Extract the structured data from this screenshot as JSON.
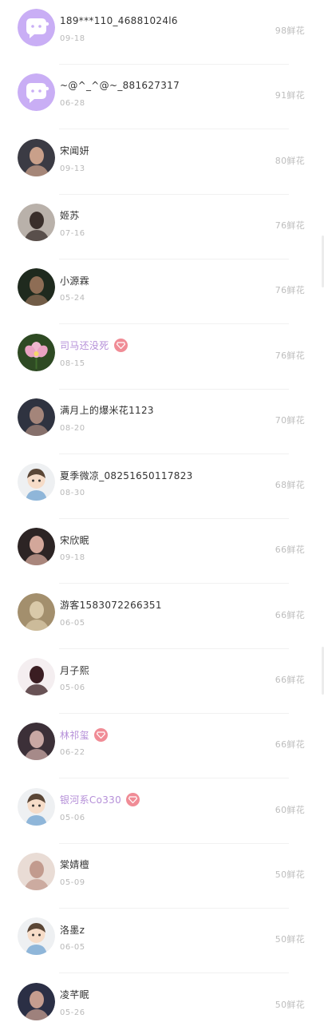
{
  "rows": [
    {
      "name": "189***110_46881024l6",
      "date": "09-18",
      "flowers": "98鲜花",
      "vip": false,
      "avatar": "default"
    },
    {
      "name": "~@^_^@~_881627317",
      "date": "06-28",
      "flowers": "91鲜花",
      "vip": false,
      "avatar": "default"
    },
    {
      "name": "宋闻妍",
      "date": "09-13",
      "flowers": "80鲜花",
      "vip": false,
      "avatar": "photo"
    },
    {
      "name": "姬苏",
      "date": "07-16",
      "flowers": "76鲜花",
      "vip": false,
      "avatar": "photo"
    },
    {
      "name": "小源霖",
      "date": "05-24",
      "flowers": "76鲜花",
      "vip": false,
      "avatar": "photo"
    },
    {
      "name": "司马还没死",
      "date": "08-15",
      "flowers": "76鲜花",
      "vip": true,
      "avatar": "flower"
    },
    {
      "name": "满月上的爆米花1123",
      "date": "08-20",
      "flowers": "70鲜花",
      "vip": false,
      "avatar": "photo"
    },
    {
      "name": "夏季微凉_08251650117823",
      "date": "08-30",
      "flowers": "68鲜花",
      "vip": false,
      "avatar": "cartoon"
    },
    {
      "name": "宋欣眠",
      "date": "09-18",
      "flowers": "66鲜花",
      "vip": false,
      "avatar": "photo"
    },
    {
      "name": "游客1583072266351",
      "date": "06-05",
      "flowers": "66鲜花",
      "vip": false,
      "avatar": "photo"
    },
    {
      "name": "月子熙",
      "date": "05-06",
      "flowers": "66鲜花",
      "vip": false,
      "avatar": "photo"
    },
    {
      "name": "林祁玺",
      "date": "06-22",
      "flowers": "66鲜花",
      "vip": true,
      "avatar": "photo"
    },
    {
      "name": "银河系Co330",
      "date": "05-06",
      "flowers": "60鲜花",
      "vip": true,
      "avatar": "cartoon"
    },
    {
      "name": "棠婧檀",
      "date": "05-09",
      "flowers": "50鲜花",
      "vip": false,
      "avatar": "photo"
    },
    {
      "name": "洛墨z",
      "date": "06-05",
      "flowers": "50鲜花",
      "vip": false,
      "avatar": "cartoon"
    },
    {
      "name": "凌芊眠",
      "date": "05-26",
      "flowers": "50鲜花",
      "vip": false,
      "avatar": "photo"
    }
  ],
  "icons": {
    "default_avatar": "chat-bubble-face-icon",
    "vip_badge": "heart-gem-icon"
  },
  "colors": {
    "default_avatar_bg": "#c9aef5",
    "vip_name": "#b58fd8",
    "vip_badge": "#f08c96",
    "secondary_text": "#b9b9b9"
  }
}
